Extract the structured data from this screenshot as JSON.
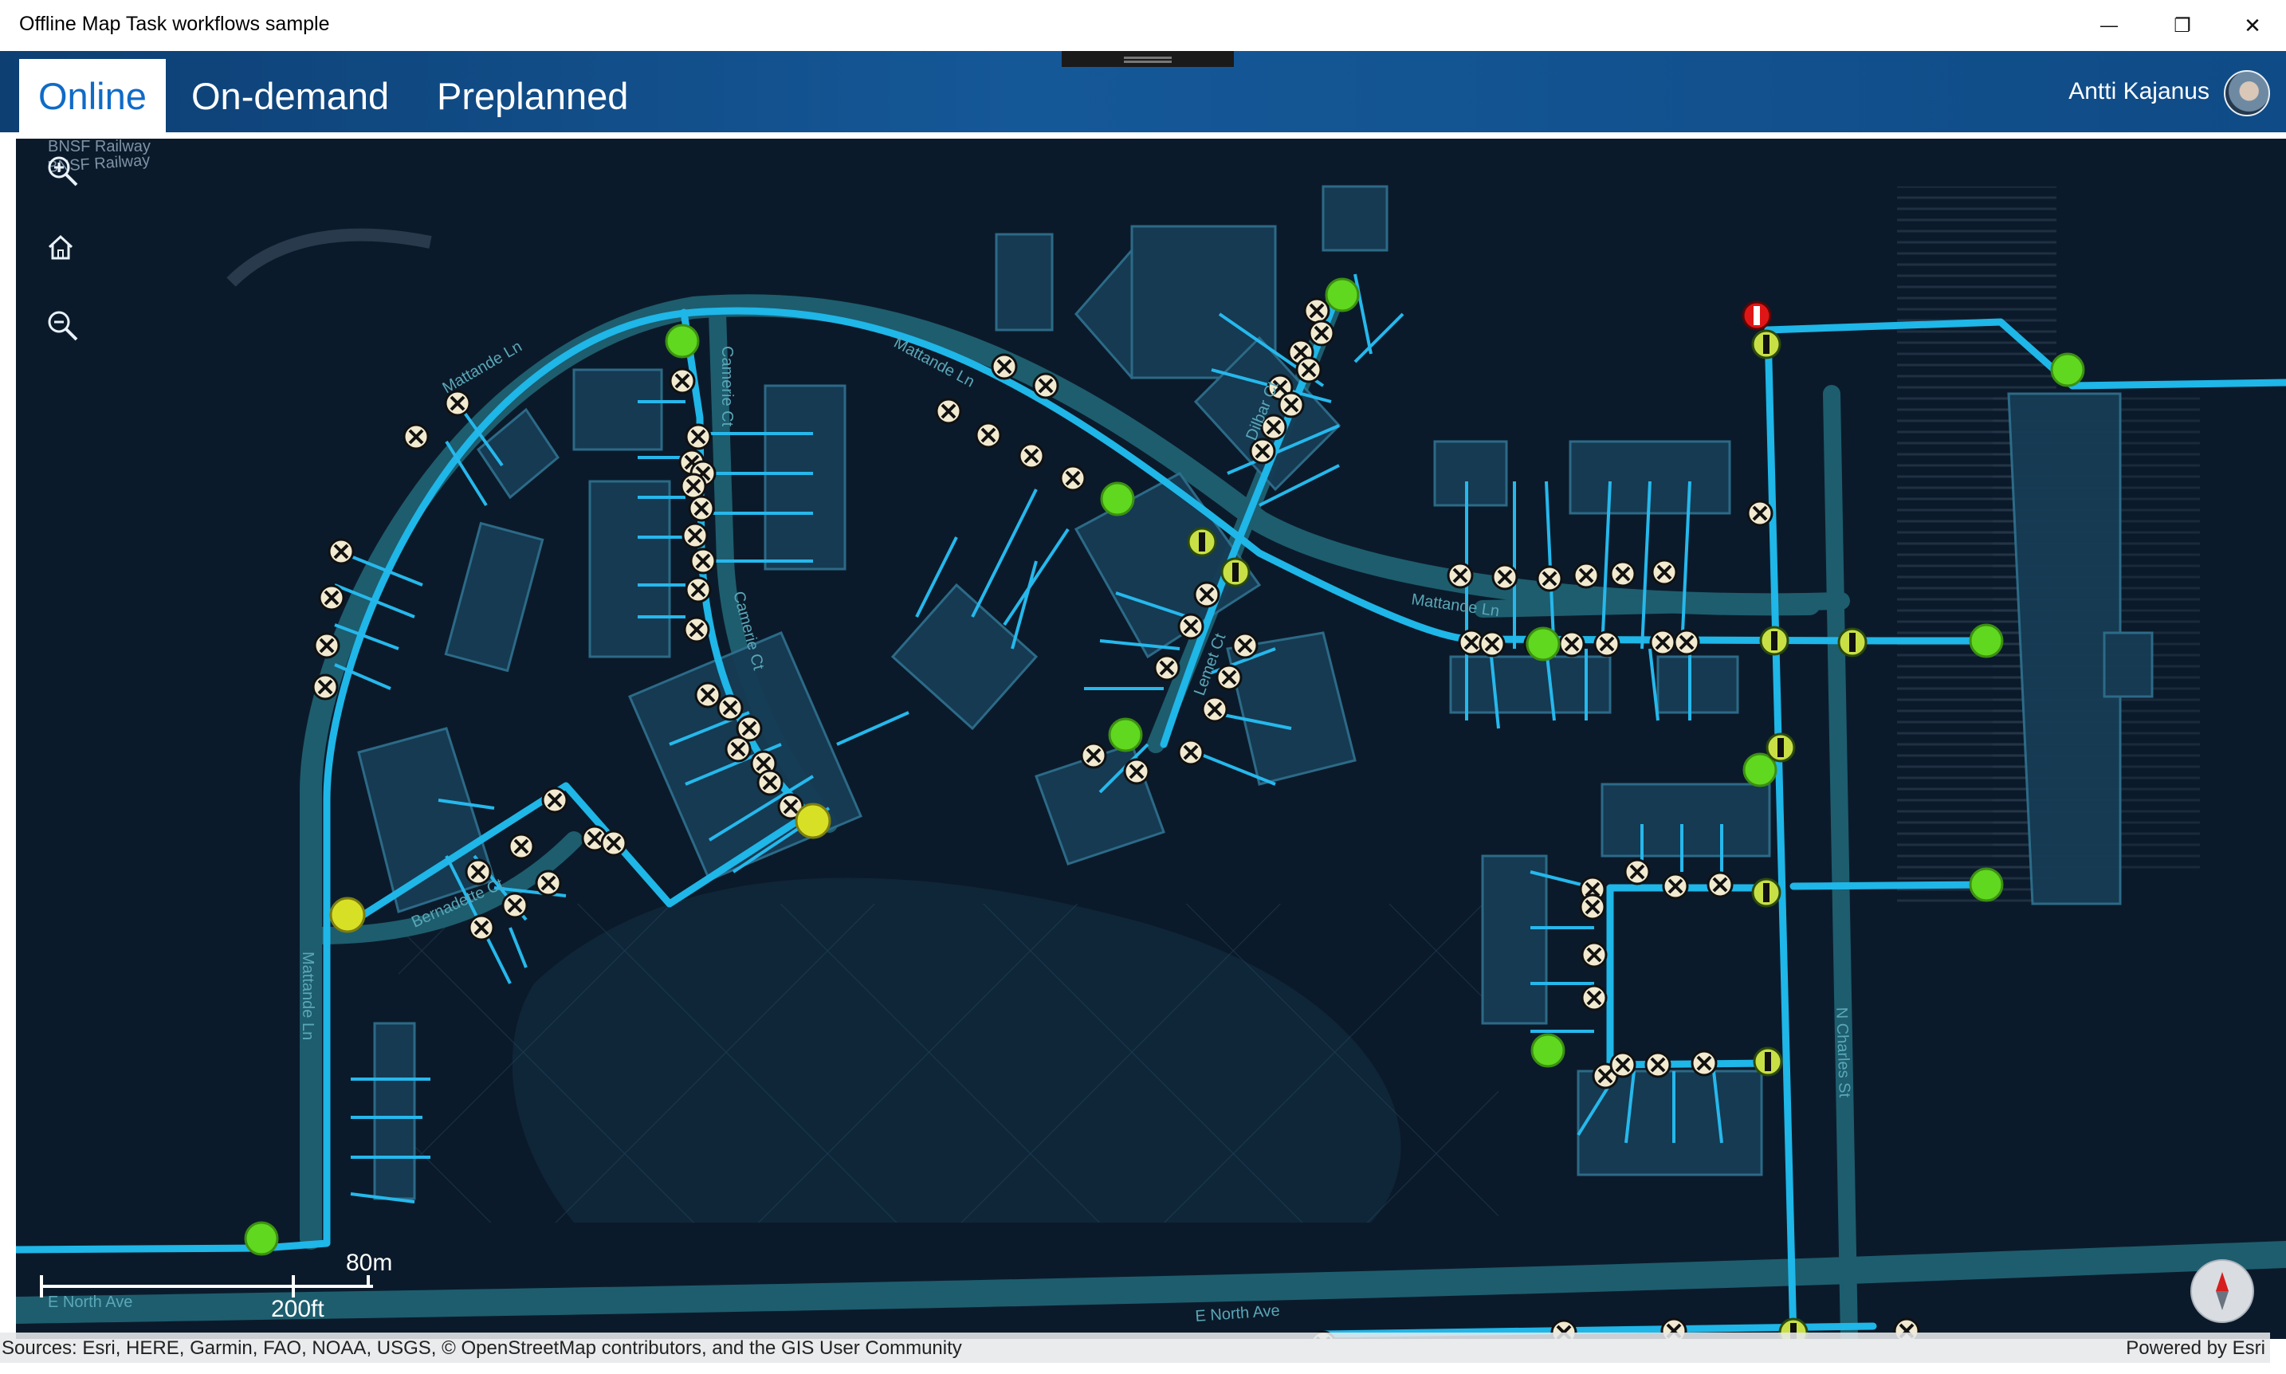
{
  "window": {
    "title": "Offline Map Task workflows sample",
    "controls": {
      "minimize": "—",
      "restore": "❐",
      "close": "✕"
    }
  },
  "tabs": [
    {
      "label": "Online",
      "active": true
    },
    {
      "label": "On-demand",
      "active": false
    },
    {
      "label": "Preplanned",
      "active": false
    }
  ],
  "user": {
    "name": "Antti Kajanus"
  },
  "map": {
    "controls": {
      "zoom_in": "zoom-in-icon",
      "home": "home-icon",
      "zoom_out": "zoom-out-icon"
    },
    "street_labels": {
      "railway_1": "BNSF Railway",
      "railway_2": "BNSF Railway",
      "mattande_1": "Mattande Ln",
      "mattande_2": "Mattande Ln",
      "mattande_3": "Mattande Ln",
      "mattande_4": "Mattande Ln",
      "camerie_1": "Camerie Ct",
      "camerie_2": "Camerie Ct",
      "bernadette": "Bernadette Ct",
      "dilbar": "Dilbar Ct",
      "lemet": "Lemet Ct",
      "charles": "N Charles St",
      "north_1": "E North Ave",
      "north_2": "E North Ave"
    },
    "scale": {
      "metric": "80m",
      "imperial": "200ft"
    },
    "attribution": "Sources: Esri, HERE, Garmin, FAO, NOAA, USGS, © OpenStreetMap contributors, and the GIS User Community",
    "powered_by": "Powered by Esri",
    "colors": {
      "background": "#0b1a2a",
      "road": "#1d5d6e",
      "utility_line": "#1fb6e8",
      "parcel": "#163c55",
      "device_green": "#5fd81f",
      "device_yellow": "#d8e026",
      "device_red": "#e01616"
    }
  }
}
